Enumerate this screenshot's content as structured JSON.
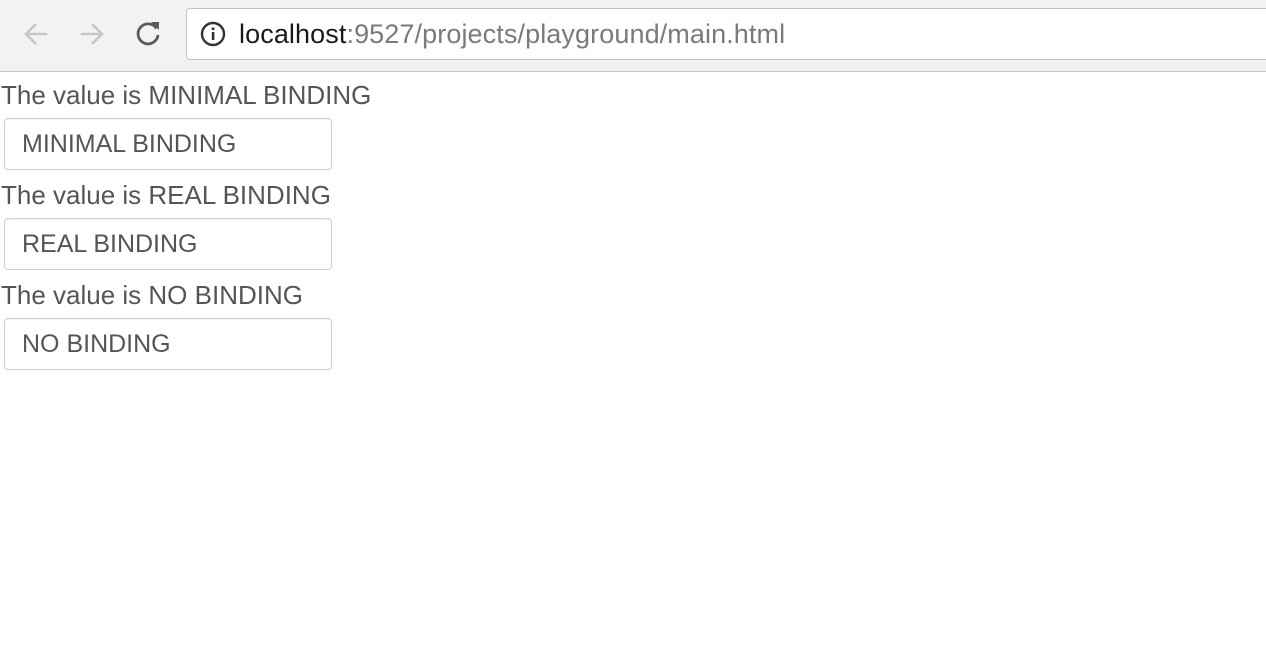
{
  "browser": {
    "url_host": "localhost",
    "url_path": ":9527/projects/playground/main.html"
  },
  "bindings": [
    {
      "label": "The value is MINIMAL BINDING",
      "value": "MINIMAL BINDING"
    },
    {
      "label": "The value is REAL BINDING",
      "value": "REAL BINDING"
    },
    {
      "label": "The value is NO BINDING",
      "value": "NO BINDING"
    }
  ]
}
